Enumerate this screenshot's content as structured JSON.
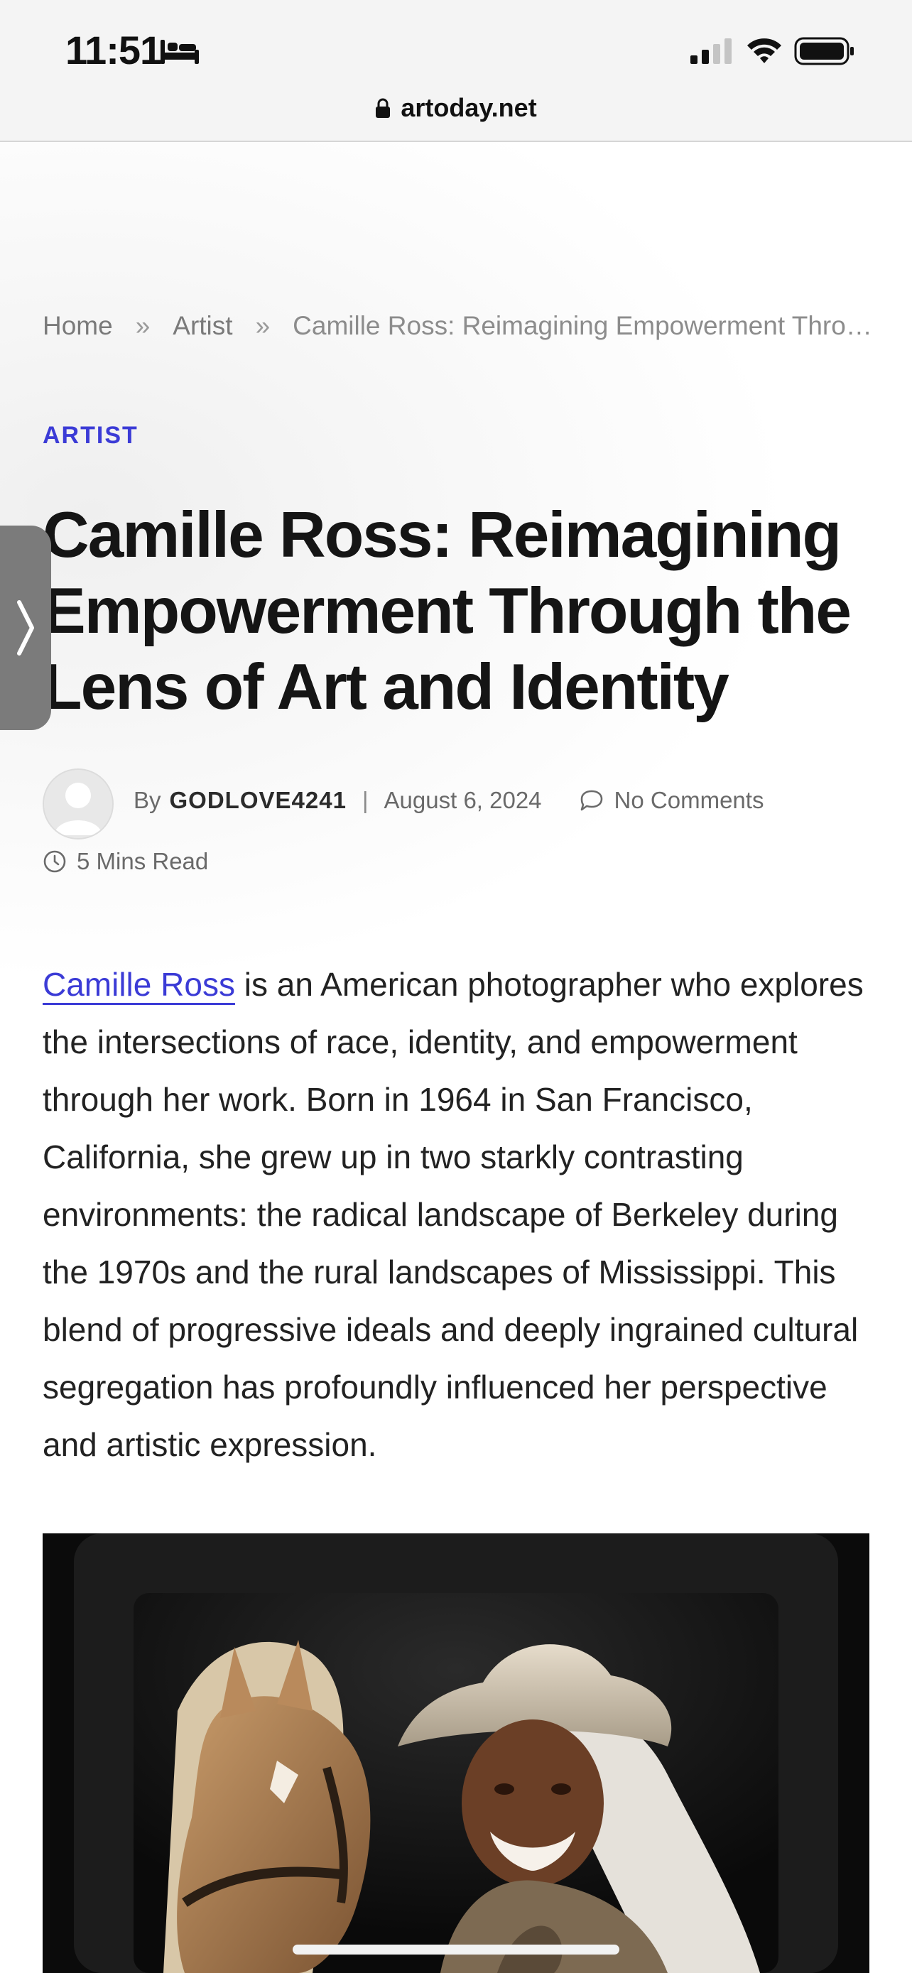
{
  "status_bar": {
    "time": "11:51",
    "focus_icon": "bed-icon",
    "signal_icon": "cellular-signal-icon",
    "wifi_icon": "wifi-icon",
    "battery_icon": "battery-icon"
  },
  "browser": {
    "url": "artoday.net",
    "lock_icon": "lock-icon"
  },
  "breadcrumb": {
    "home": "Home",
    "separator": "»",
    "section": "Artist",
    "current": "Camille Ross: Reimagining Empowerment Through the Lens of Art and Identity"
  },
  "article": {
    "category": "ARTIST",
    "title": "Camille Ross: Reimagining Empowerment Through the Lens of Art and Identity",
    "by_label": "By",
    "author": "GODLOVE4241",
    "date": "August 6, 2024",
    "comments": "No Comments",
    "read_time": "5 Mins Read",
    "lead_link": "Camille Ross",
    "lead_text": " is an American photographer who explores the intersections of race, identity, and empowerment through her work. Born in 1964 in San Francisco, California, she grew up in two starkly contrasting environments: the radical landscape of Berkeley during the 1970s and the rural landscapes of Mississippi. This blend of progressive ideals and deeply ingrained cultural segregation has profoundly influenced her perspective and artistic expression."
  },
  "side_tab": {
    "icon": "chevron-right-icon"
  },
  "colors": {
    "accent": "#3b3bd6",
    "title": "#151515",
    "meta": "#6a6a6a"
  }
}
